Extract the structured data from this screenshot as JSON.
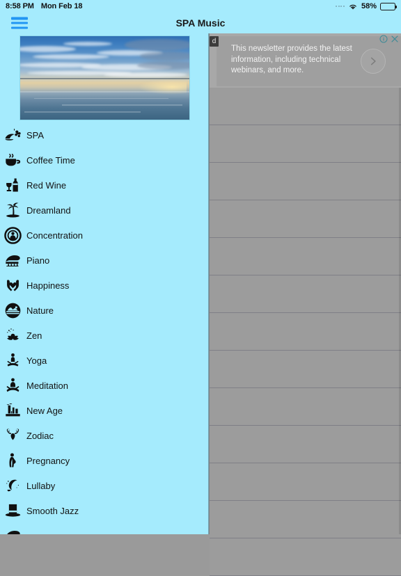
{
  "status_bar": {
    "time": "8:58 PM",
    "date": "Mon Feb 18",
    "signal_icon": "signal-dots-icon",
    "wifi_icon": "wifi-icon",
    "battery_percent": "58%",
    "battery_icon": "battery-icon",
    "battery_level": 58
  },
  "nav_bar": {
    "menu_icon": "hamburger-icon",
    "title": "SPA Music"
  },
  "sidebar": {
    "hero_image_alt": "ocean sunset photo",
    "items": [
      {
        "label": "SPA",
        "icon": "spa-stones-icon"
      },
      {
        "label": "Coffee Time",
        "icon": "coffee-cup-icon"
      },
      {
        "label": "Red Wine",
        "icon": "wine-bottle-glass-icon"
      },
      {
        "label": "Dreamland",
        "icon": "palm-tree-icon"
      },
      {
        "label": "Concentration",
        "icon": "target-person-icon"
      },
      {
        "label": "Piano",
        "icon": "grand-piano-icon"
      },
      {
        "label": "Happiness",
        "icon": "hands-heart-icon"
      },
      {
        "label": "Nature",
        "icon": "mountain-circle-icon"
      },
      {
        "label": "Zen",
        "icon": "lotus-flower-icon"
      },
      {
        "label": "Yoga",
        "icon": "yoga-pose-icon"
      },
      {
        "label": "Meditation",
        "icon": "meditation-pose-icon"
      },
      {
        "label": "New Age",
        "icon": "rock-formation-icon"
      },
      {
        "label": "Zodiac",
        "icon": "aries-ram-icon"
      },
      {
        "label": "Pregnancy",
        "icon": "pregnant-woman-icon"
      },
      {
        "label": "Lullaby",
        "icon": "crescent-moon-icon"
      },
      {
        "label": "Smooth Jazz",
        "icon": "top-hat-icon"
      },
      {
        "label": "",
        "icon": "grand-piano-icon"
      }
    ]
  },
  "ad_banner": {
    "badge": "d",
    "text": "This newsletter provides the latest information, including technical webinars, and more.",
    "arrow_icon": "chevron-right-icon",
    "info_icon": "info-icon",
    "close_icon": "close-icon"
  },
  "content": {
    "row_count": 13
  },
  "colors": {
    "sidebar_bg": "#A5EBFD",
    "accent_blue": "#2196F3",
    "overlay_gray": "#9a9a9a",
    "ad_icon_teal": "#3c8a96"
  }
}
